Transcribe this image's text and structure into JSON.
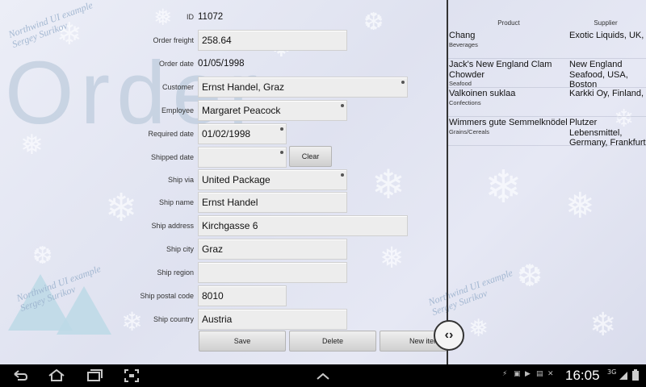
{
  "form": {
    "id_label": "ID",
    "id_value": "11072",
    "order_freight_label": "Order freight",
    "order_freight_value": "258.64",
    "order_date_label": "Order date",
    "order_date_value": "01/05/1998",
    "customer_label": "Customer",
    "customer_value": "Ernst Handel, Graz",
    "employee_label": "Employee",
    "employee_value": "Margaret Peacock",
    "required_date_label": "Required date",
    "required_date_value": "01/02/1998",
    "shipped_date_label": "Shipped date",
    "shipped_date_value": "",
    "clear_label": "Clear",
    "ship_via_label": "Ship via",
    "ship_via_value": "United Package",
    "ship_name_label": "Ship name",
    "ship_name_value": "Ernst Handel",
    "ship_address_label": "Ship address",
    "ship_address_value": "Kirchgasse 6",
    "ship_city_label": "Ship city",
    "ship_city_value": "Graz",
    "ship_region_label": "Ship region",
    "ship_region_value": "",
    "ship_postal_code_label": "Ship postal code",
    "ship_postal_code_value": "8010",
    "ship_country_label": "Ship country",
    "ship_country_value": "Austria"
  },
  "actions": {
    "save": "Save",
    "delete": "Delete",
    "new_item": "New item"
  },
  "background": {
    "title_word": "Order",
    "watermark_line1": "Northwind UI example",
    "watermark_line2": "Sergey Surikov"
  },
  "details": {
    "product_header": "Product",
    "supplier_header": "Supplier",
    "rows": [
      {
        "product": "Chang",
        "category": "Beverages",
        "supplier": "Exotic Liquids, UK, London"
      },
      {
        "product": "Jack's New England Clam Chowder",
        "category": "Seafood",
        "supplier": "New England Seafood, USA, Boston"
      },
      {
        "product": "Valkoinen suklaa",
        "category": "Confections",
        "supplier": "Karkki Oy, Finland, Lappeenranta"
      },
      {
        "product": "Wimmers gute Semmelknödel",
        "category": "Grains/Cereals",
        "supplier": "Plutzer Lebensmittel, Germany, Frankfurt"
      }
    ]
  },
  "statusbar": {
    "time": "16:05",
    "network": "3G",
    "icons": [
      "back-icon",
      "home-icon",
      "recent-apps-icon",
      "screenshot-icon",
      "up-chevron-icon",
      "usb-icon",
      "gallery-icon",
      "media-icon",
      "signal-icon",
      "battery-icon"
    ]
  },
  "colors": {
    "accent": "#333333",
    "button_top": "#efefef",
    "button_bottom": "#cfcfcf",
    "field_bg": "#ededed",
    "statusbar_bg": "#000000"
  }
}
